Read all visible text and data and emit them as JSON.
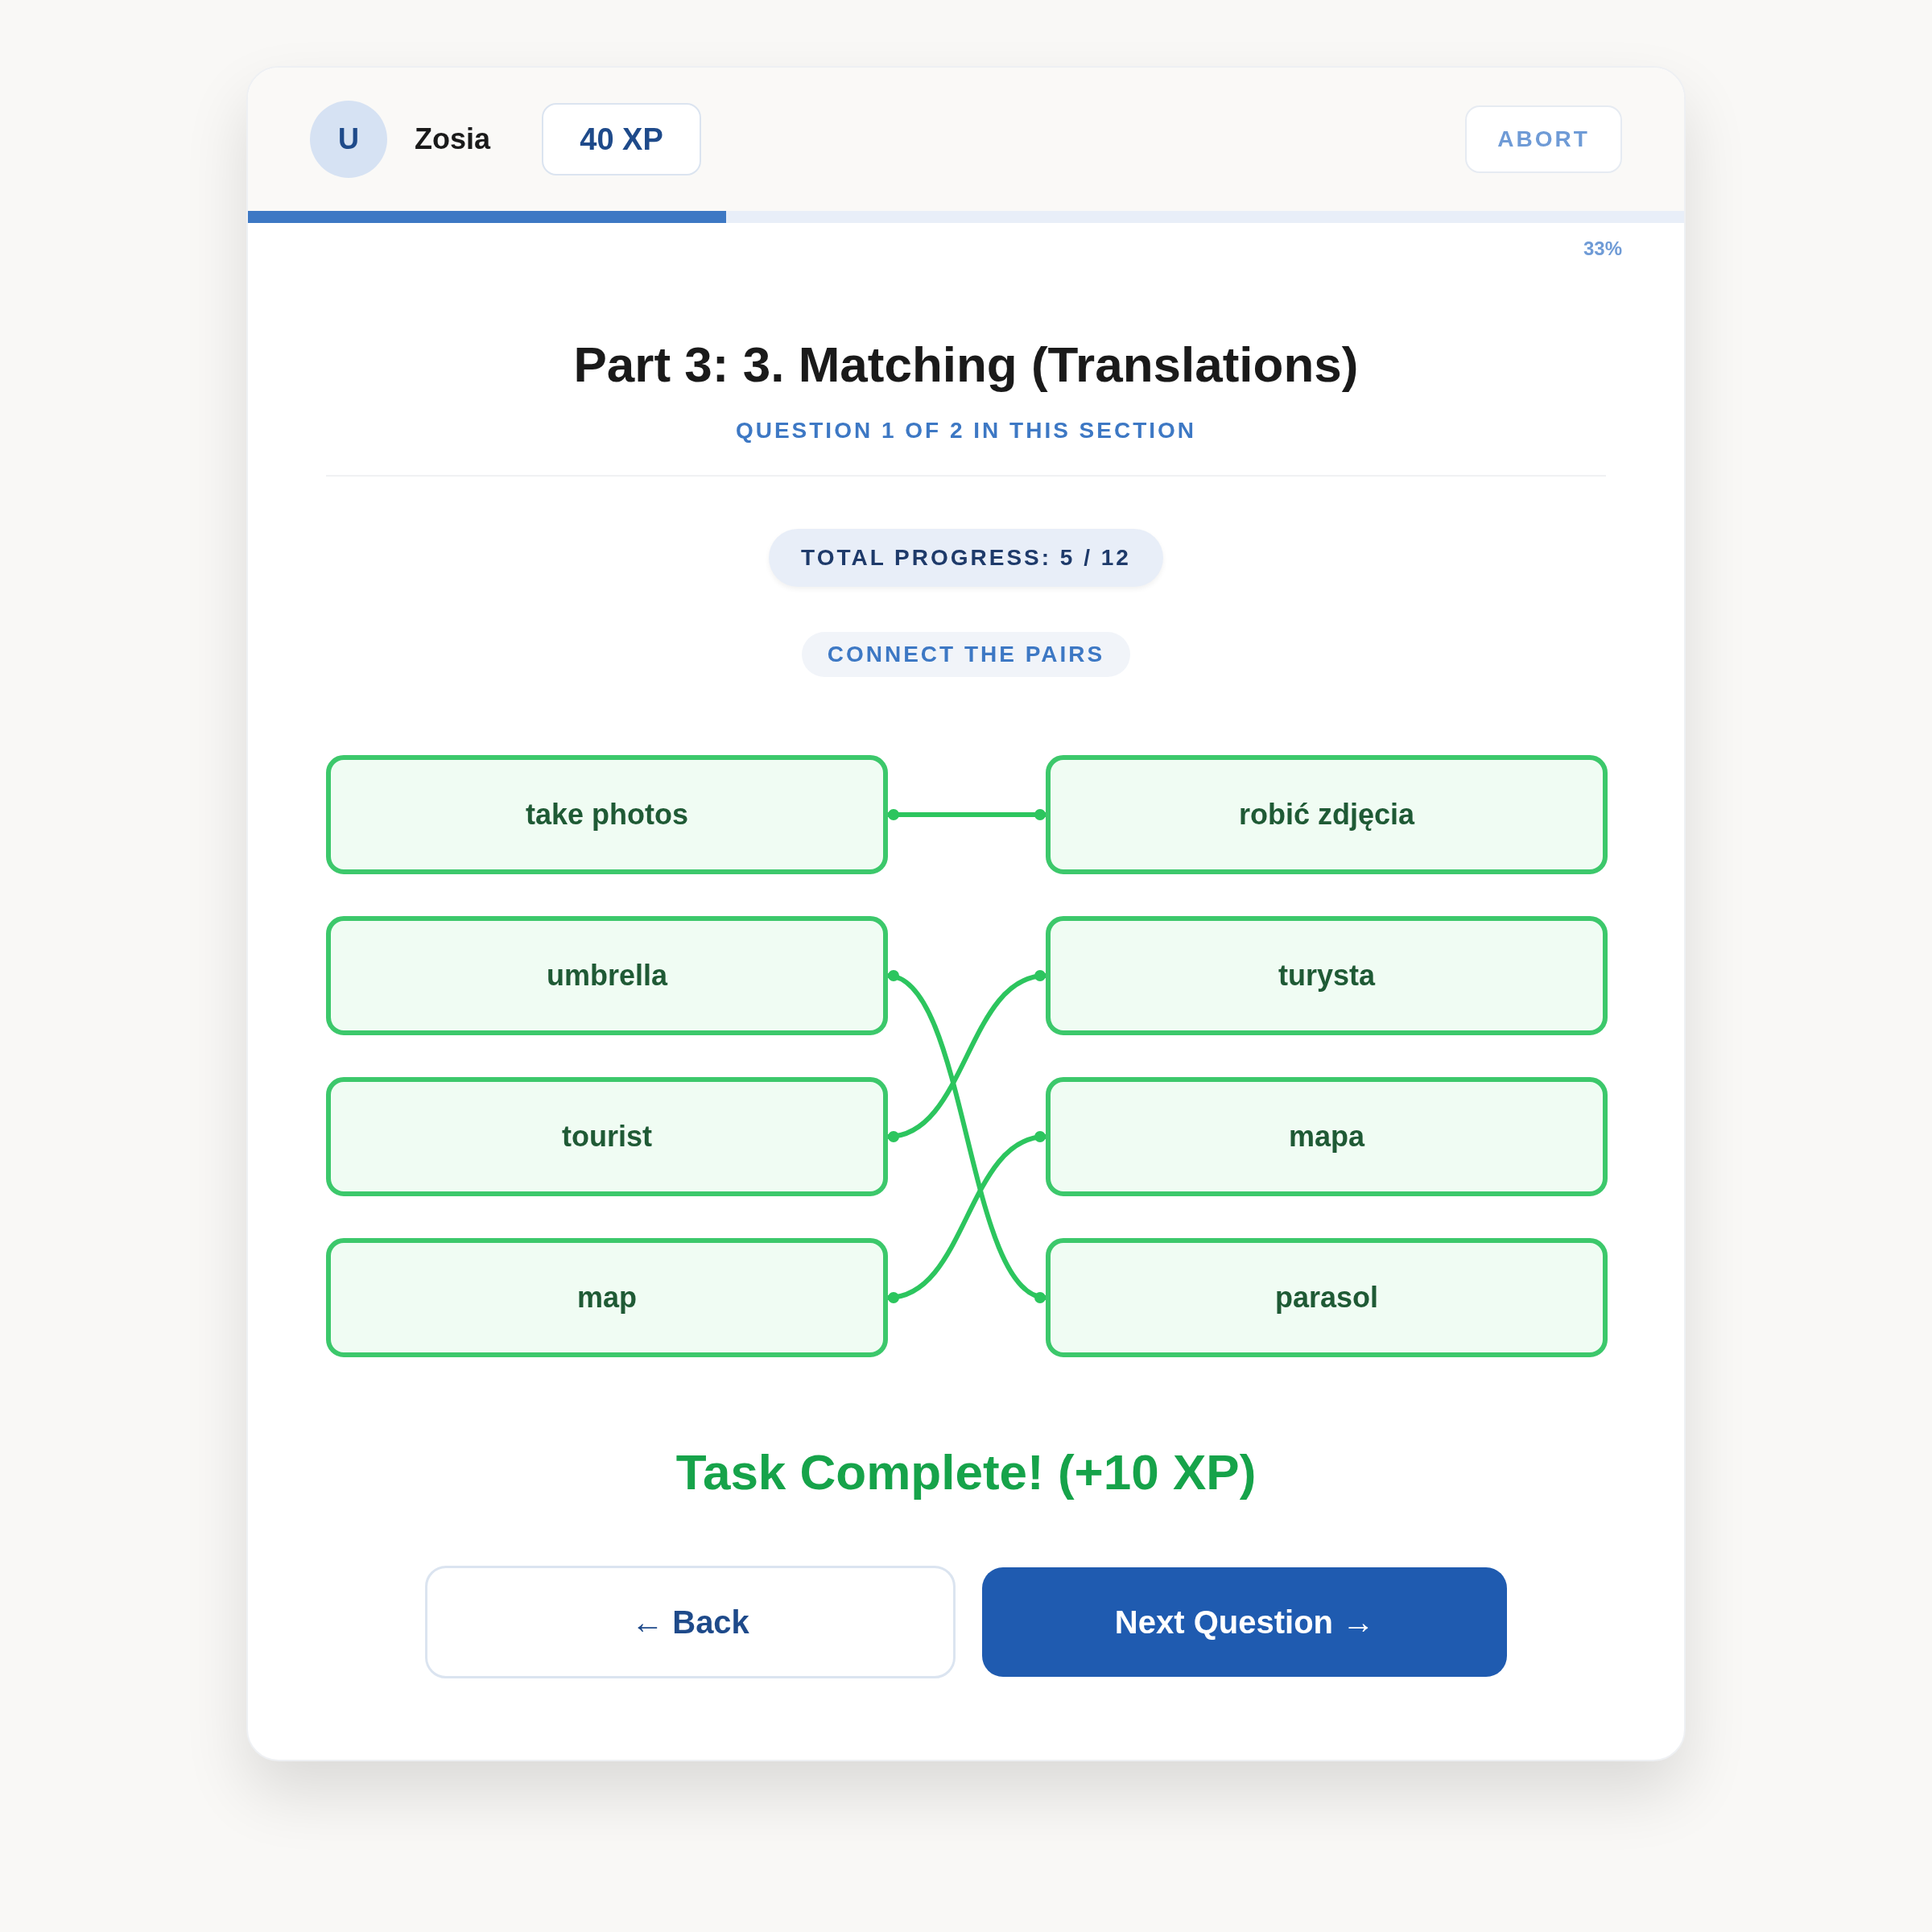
{
  "header": {
    "avatar": "U",
    "user_name": "Zosia",
    "xp": "40 XP",
    "abort_button": "ABORT"
  },
  "progress": {
    "level": 0.333,
    "reading": "33%"
  },
  "title": "Part 3: 3. Matching (Translations)",
  "subtitle": "QUESTION 1 OF 2 IN THIS SECTION",
  "total_progress": "TOTAL PROGRESS: 5 / 12",
  "instruction": "CONNECT THE PAIRS",
  "left_items": [
    {
      "label": "take photos",
      "matched": true
    },
    {
      "label": "umbrella",
      "matched": true
    },
    {
      "label": "tourist",
      "matched": true
    },
    {
      "label": "map",
      "matched": true
    }
  ],
  "connectors": [
    {
      "kind": "level"
    },
    {
      "kind": "down-two"
    },
    {
      "kind": "up-one"
    },
    {
      "kind": "up-one"
    }
  ],
  "right_items": [
    {
      "label": "robić zdjęcia",
      "matched": true
    },
    {
      "label": "turysta",
      "matched": true
    },
    {
      "label": "mapa",
      "matched": true
    },
    {
      "label": "parasol",
      "matched": true
    }
  ],
  "result": "Task Complete! (+10 XP)",
  "buttons": [
    {
      "label": "← Back",
      "kind": "secondary"
    },
    {
      "label": "Next Question →",
      "kind": "primary"
    }
  ]
}
